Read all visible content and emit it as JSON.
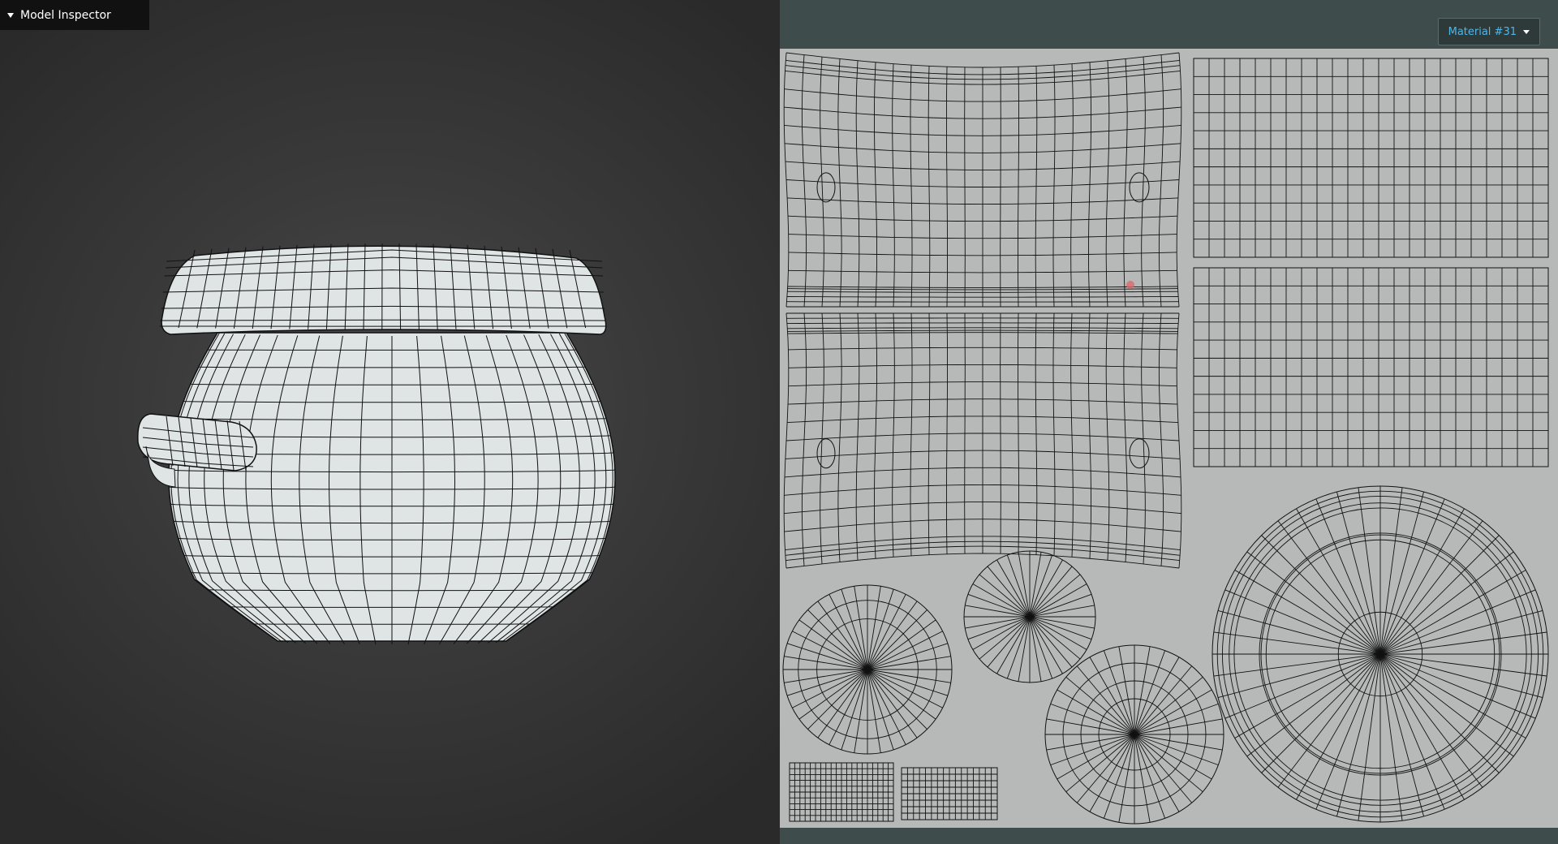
{
  "viewport": {
    "tab_label": "Model Inspector",
    "background_color": "#3a3a3a"
  },
  "uv_editor": {
    "material_label": "Material #31",
    "accent_color": "#4fb6e8",
    "canvas_color": "#b7b9b8",
    "header_color": "#3f4c4c"
  }
}
